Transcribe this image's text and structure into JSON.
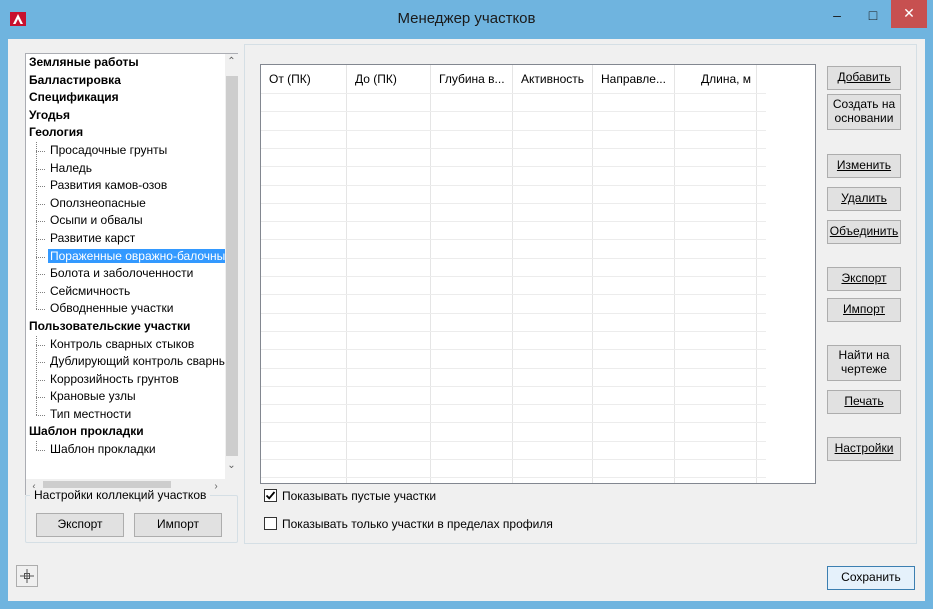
{
  "window": {
    "title": "Менеджер участков",
    "minimize": "–",
    "maximize": "□",
    "close": "✕"
  },
  "tree": {
    "items": [
      {
        "type": "cat",
        "label": "Земляные работы"
      },
      {
        "type": "cat",
        "label": "Балластировка"
      },
      {
        "type": "cat",
        "label": "Спецификация"
      },
      {
        "type": "cat",
        "label": "Угодья"
      },
      {
        "type": "cat",
        "label": "Геология"
      },
      {
        "type": "child",
        "label": "Просадочные грунты"
      },
      {
        "type": "child",
        "label": "Наледь"
      },
      {
        "type": "child",
        "label": "Развития камов-озов"
      },
      {
        "type": "child",
        "label": "Оползнеопасные"
      },
      {
        "type": "child",
        "label": "Осыпи и обвалы"
      },
      {
        "type": "child",
        "label": "Развитие карст"
      },
      {
        "type": "child",
        "label": "Пораженные овражно-балочные",
        "selected": true
      },
      {
        "type": "child",
        "label": "Болота и заболоченности"
      },
      {
        "type": "child",
        "label": "Сейсмичность"
      },
      {
        "type": "child",
        "label": "Обводненные участки"
      },
      {
        "type": "cat",
        "label": "Пользовательские участки"
      },
      {
        "type": "child",
        "label": "Контроль сварных стыков"
      },
      {
        "type": "child",
        "label": "Дублирующий контроль сварных"
      },
      {
        "type": "child",
        "label": "Коррозийность грунтов"
      },
      {
        "type": "child",
        "label": "Крановые узлы"
      },
      {
        "type": "child",
        "label": "Тип местности"
      },
      {
        "type": "cat",
        "label": "Шаблон прокладки"
      },
      {
        "type": "child",
        "label": "Шаблон прокладки"
      }
    ]
  },
  "collections": {
    "title": "Настройки коллекций участков",
    "export_label": "Экспорт",
    "import_label": "Импорт"
  },
  "grid": {
    "columns": [
      "От (ПК)",
      "До (ПК)",
      "Глубина в...",
      "Активность",
      "Направле...",
      "Длина, м"
    ]
  },
  "options": {
    "show_empty_label": "Показывать пустые участки",
    "show_empty_checked": true,
    "show_profile_label": "Показывать только участки в пределах профиля",
    "show_profile_checked": false
  },
  "actions": {
    "add": "Добавить",
    "create_based": "Создать на основании",
    "edit": "Изменить",
    "delete": "Удалить",
    "merge": "Объединить",
    "export": "Экспорт",
    "import": "Импорт",
    "find": "Найти на чертеже",
    "print": "Печать",
    "settings": "Настройки",
    "save": "Сохранить"
  },
  "icons": {
    "app": "autocad-logo-icon",
    "pick": "crosshair-pick-icon"
  }
}
